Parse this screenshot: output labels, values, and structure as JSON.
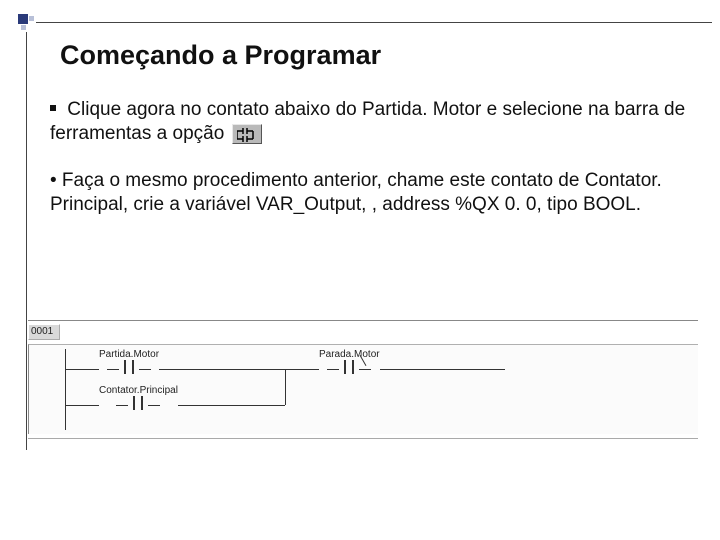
{
  "title": "Começando a Programar",
  "para1a": "Clique agora no contato abaixo do Partida. Motor e selecione na barra de ferramentas a opção",
  "para2": "• Faça o mesmo procedimento anterior, chame este contato de Contator. Principal, crie a variável VAR_Output, , address %QX 0. 0, tipo BOOL.",
  "ladder": {
    "row_number": "0001",
    "contacts": {
      "c1": "Partida.Motor",
      "c2": "Parada.Motor",
      "c3": "Contator.Principal"
    }
  }
}
